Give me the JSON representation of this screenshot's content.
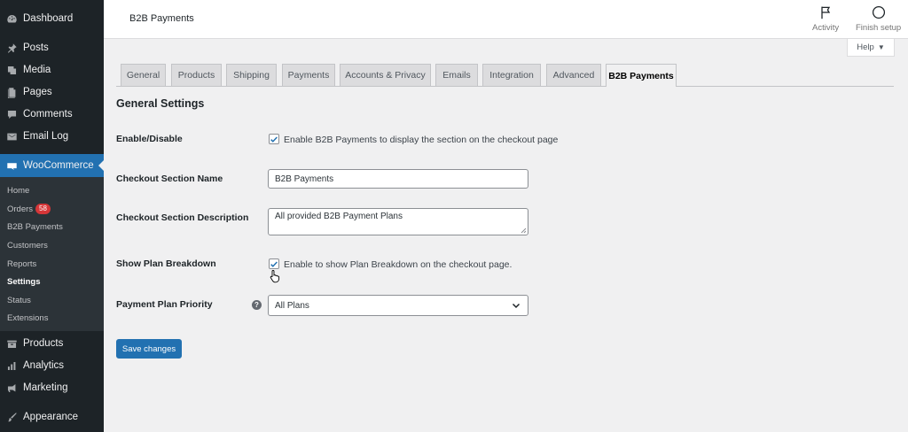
{
  "sidebar": {
    "items": [
      {
        "label": "Dashboard",
        "icon": "dashboard-icon"
      },
      {
        "label": "Posts",
        "icon": "pin-icon"
      },
      {
        "label": "Media",
        "icon": "media-icon"
      },
      {
        "label": "Pages",
        "icon": "pages-icon"
      },
      {
        "label": "Comments",
        "icon": "comment-icon"
      },
      {
        "label": "Email Log",
        "icon": "email-icon"
      },
      {
        "label": "WooCommerce",
        "icon": "woo-icon"
      },
      {
        "label": "Products",
        "icon": "products-icon"
      },
      {
        "label": "Analytics",
        "icon": "analytics-icon"
      },
      {
        "label": "Marketing",
        "icon": "megaphone-icon"
      },
      {
        "label": "Appearance",
        "icon": "brush-icon"
      }
    ],
    "woo_submenu": [
      {
        "label": "Home"
      },
      {
        "label": "Orders",
        "badge": "58"
      },
      {
        "label": "B2B Payments"
      },
      {
        "label": "Customers"
      },
      {
        "label": "Reports"
      },
      {
        "label": "Settings",
        "current": true
      },
      {
        "label": "Status"
      },
      {
        "label": "Extensions"
      }
    ]
  },
  "header": {
    "title": "B2B Payments",
    "activity_label": "Activity",
    "finish_setup_label": "Finish setup",
    "help_label": "Help"
  },
  "tabs": [
    {
      "label": "General"
    },
    {
      "label": "Products"
    },
    {
      "label": "Shipping"
    },
    {
      "label": "Payments"
    },
    {
      "label": "Accounts & Privacy"
    },
    {
      "label": "Emails"
    },
    {
      "label": "Integration"
    },
    {
      "label": "Advanced"
    },
    {
      "label": "B2B Payments",
      "active": true
    }
  ],
  "form": {
    "section_title": "General Settings",
    "enable": {
      "label": "Enable/Disable",
      "checkbox_label": "Enable B2B Payments to display the section on the checkout page",
      "checked": true
    },
    "section_name": {
      "label": "Checkout Section Name",
      "value": "B2B Payments"
    },
    "section_description": {
      "label": "Checkout Section Description",
      "value": "All provided B2B Payment Plans"
    },
    "plan_breakdown": {
      "label": "Show Plan Breakdown",
      "checkbox_label": "Enable to show Plan Breakdown on the checkout page.",
      "checked": true
    },
    "priority": {
      "label": "Payment Plan Priority",
      "help_glyph": "?",
      "selected": "All Plans"
    },
    "save_label": "Save changes"
  },
  "colors": {
    "accent": "#2271b1",
    "sidebar_bg": "#1d2327",
    "badge": "#d63638"
  }
}
